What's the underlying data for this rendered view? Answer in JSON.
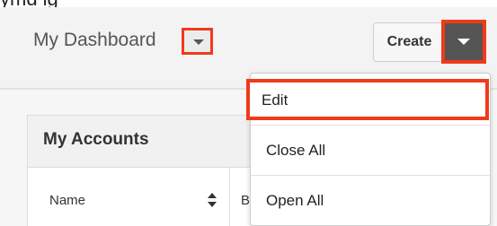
{
  "header": {
    "title": "My Dashboard",
    "create_label": "Create"
  },
  "dashlet": {
    "title": "My Accounts",
    "columns": [
      "Name",
      "B"
    ]
  },
  "dropdown": {
    "items": [
      "Edit",
      "Close All",
      "Open All"
    ]
  },
  "top_fragment": "ymd     ig",
  "colors": {
    "highlight": "#f03a1a",
    "header_bg": "#f3f3f3",
    "caret_dark": "#555555"
  },
  "icons": {
    "title_caret": "chevron-down-icon",
    "create_caret": "chevron-down-icon",
    "sort": "sort-icon"
  }
}
